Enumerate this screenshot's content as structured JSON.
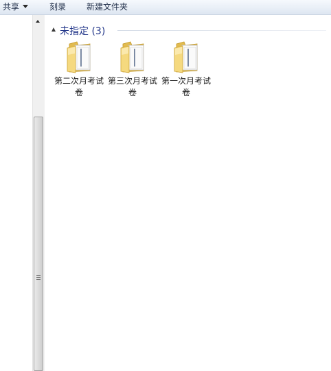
{
  "toolbar": {
    "share_label": "共享",
    "burn_label": "刻录",
    "new_folder_label": "新建文件夹"
  },
  "group": {
    "label": "未指定 (3)"
  },
  "items": [
    {
      "name": "第二次月考试卷",
      "icon": "folder-icon"
    },
    {
      "name": "第三次月考试卷",
      "icon": "folder-icon"
    },
    {
      "name": "第一次月考试卷",
      "icon": "folder-icon"
    }
  ],
  "colors": {
    "group_header": "#1e3287",
    "folder_back": "#e7c25b",
    "folder_front": "#f6dc85"
  }
}
